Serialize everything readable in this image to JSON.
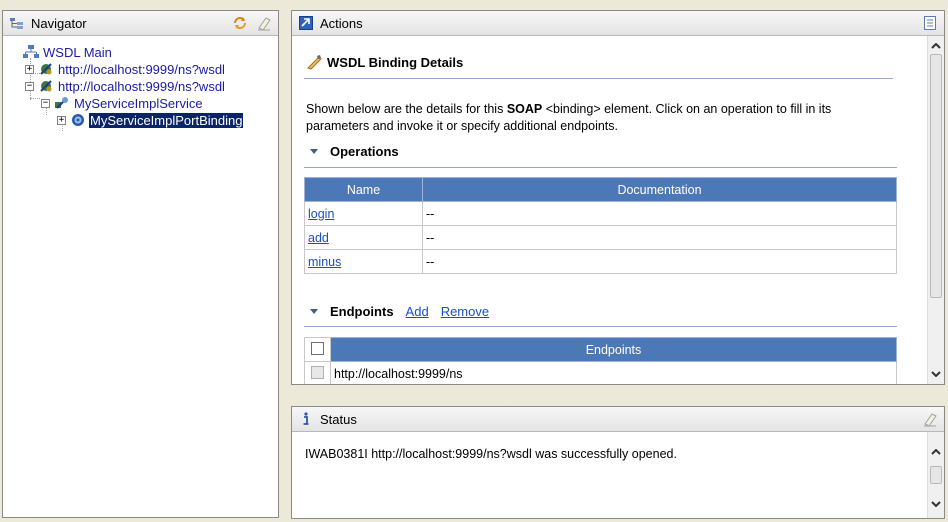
{
  "navigator": {
    "title": "Navigator",
    "tree": [
      {
        "label": "WSDL Main",
        "icon": "wsdl-main-icon"
      },
      {
        "label": "http://localhost:9999/ns?wsdl",
        "icon": "wsdl-document-icon"
      },
      {
        "label": "http://localhost:9999/ns?wsdl",
        "icon": "wsdl-document-icon"
      },
      {
        "label": "MyServiceImplService",
        "icon": "service-icon"
      },
      {
        "label": "MyServiceImplPortBinding",
        "icon": "binding-icon",
        "selected": true
      }
    ]
  },
  "actions": {
    "title": "Actions",
    "heading": "WSDL Binding Details",
    "desc_pre": "Shown below are the details for this ",
    "desc_bold": "SOAP",
    "desc_post": " <binding> element. Click on an operation to fill in its parameters and invoke it or specify additional endpoints.",
    "operations": {
      "title": "Operations",
      "columns": [
        "Name",
        "Documentation"
      ],
      "rows": [
        {
          "name": "login",
          "doc": "--"
        },
        {
          "name": "add",
          "doc": "--"
        },
        {
          "name": "minus",
          "doc": "--"
        }
      ]
    },
    "endpoints": {
      "title": "Endpoints",
      "add_label": "Add",
      "remove_label": "Remove",
      "column": "Endpoints",
      "rows": [
        "http://localhost:9999/ns"
      ]
    }
  },
  "status": {
    "title": "Status",
    "message": "IWAB0381I http://localhost:9999/ns?wsdl was successfully opened."
  },
  "colors": {
    "table_header": "#4d78b8",
    "link": "#1a4ec4",
    "tree_link": "#1a1aa6",
    "selection": "#0a246a"
  }
}
